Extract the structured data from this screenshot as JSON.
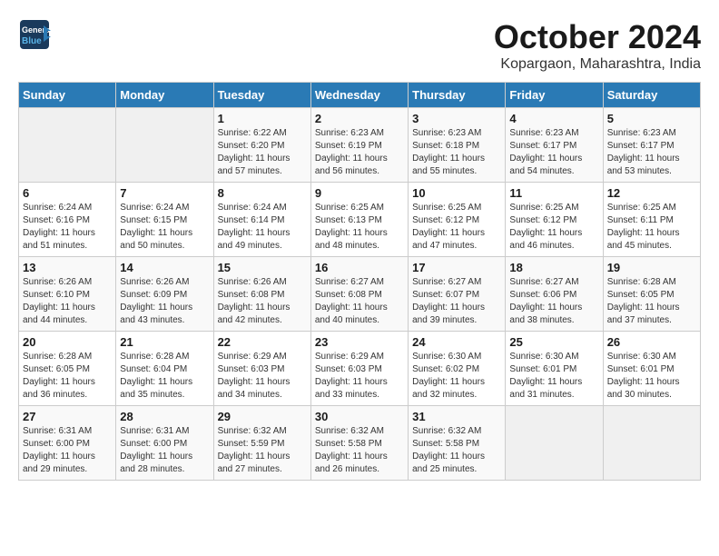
{
  "header": {
    "logo_line1": "General",
    "logo_line2": "Blue",
    "title": "October 2024",
    "subtitle": "Kopargaon, Maharashtra, India"
  },
  "calendar": {
    "headers": [
      "Sunday",
      "Monday",
      "Tuesday",
      "Wednesday",
      "Thursday",
      "Friday",
      "Saturday"
    ],
    "weeks": [
      [
        {
          "day": "",
          "info": ""
        },
        {
          "day": "",
          "info": ""
        },
        {
          "day": "1",
          "info": "Sunrise: 6:22 AM\nSunset: 6:20 PM\nDaylight: 11 hours and 57 minutes."
        },
        {
          "day": "2",
          "info": "Sunrise: 6:23 AM\nSunset: 6:19 PM\nDaylight: 11 hours and 56 minutes."
        },
        {
          "day": "3",
          "info": "Sunrise: 6:23 AM\nSunset: 6:18 PM\nDaylight: 11 hours and 55 minutes."
        },
        {
          "day": "4",
          "info": "Sunrise: 6:23 AM\nSunset: 6:17 PM\nDaylight: 11 hours and 54 minutes."
        },
        {
          "day": "5",
          "info": "Sunrise: 6:23 AM\nSunset: 6:17 PM\nDaylight: 11 hours and 53 minutes."
        }
      ],
      [
        {
          "day": "6",
          "info": "Sunrise: 6:24 AM\nSunset: 6:16 PM\nDaylight: 11 hours and 51 minutes."
        },
        {
          "day": "7",
          "info": "Sunrise: 6:24 AM\nSunset: 6:15 PM\nDaylight: 11 hours and 50 minutes."
        },
        {
          "day": "8",
          "info": "Sunrise: 6:24 AM\nSunset: 6:14 PM\nDaylight: 11 hours and 49 minutes."
        },
        {
          "day": "9",
          "info": "Sunrise: 6:25 AM\nSunset: 6:13 PM\nDaylight: 11 hours and 48 minutes."
        },
        {
          "day": "10",
          "info": "Sunrise: 6:25 AM\nSunset: 6:12 PM\nDaylight: 11 hours and 47 minutes."
        },
        {
          "day": "11",
          "info": "Sunrise: 6:25 AM\nSunset: 6:12 PM\nDaylight: 11 hours and 46 minutes."
        },
        {
          "day": "12",
          "info": "Sunrise: 6:25 AM\nSunset: 6:11 PM\nDaylight: 11 hours and 45 minutes."
        }
      ],
      [
        {
          "day": "13",
          "info": "Sunrise: 6:26 AM\nSunset: 6:10 PM\nDaylight: 11 hours and 44 minutes."
        },
        {
          "day": "14",
          "info": "Sunrise: 6:26 AM\nSunset: 6:09 PM\nDaylight: 11 hours and 43 minutes."
        },
        {
          "day": "15",
          "info": "Sunrise: 6:26 AM\nSunset: 6:08 PM\nDaylight: 11 hours and 42 minutes."
        },
        {
          "day": "16",
          "info": "Sunrise: 6:27 AM\nSunset: 6:08 PM\nDaylight: 11 hours and 40 minutes."
        },
        {
          "day": "17",
          "info": "Sunrise: 6:27 AM\nSunset: 6:07 PM\nDaylight: 11 hours and 39 minutes."
        },
        {
          "day": "18",
          "info": "Sunrise: 6:27 AM\nSunset: 6:06 PM\nDaylight: 11 hours and 38 minutes."
        },
        {
          "day": "19",
          "info": "Sunrise: 6:28 AM\nSunset: 6:05 PM\nDaylight: 11 hours and 37 minutes."
        }
      ],
      [
        {
          "day": "20",
          "info": "Sunrise: 6:28 AM\nSunset: 6:05 PM\nDaylight: 11 hours and 36 minutes."
        },
        {
          "day": "21",
          "info": "Sunrise: 6:28 AM\nSunset: 6:04 PM\nDaylight: 11 hours and 35 minutes."
        },
        {
          "day": "22",
          "info": "Sunrise: 6:29 AM\nSunset: 6:03 PM\nDaylight: 11 hours and 34 minutes."
        },
        {
          "day": "23",
          "info": "Sunrise: 6:29 AM\nSunset: 6:03 PM\nDaylight: 11 hours and 33 minutes."
        },
        {
          "day": "24",
          "info": "Sunrise: 6:30 AM\nSunset: 6:02 PM\nDaylight: 11 hours and 32 minutes."
        },
        {
          "day": "25",
          "info": "Sunrise: 6:30 AM\nSunset: 6:01 PM\nDaylight: 11 hours and 31 minutes."
        },
        {
          "day": "26",
          "info": "Sunrise: 6:30 AM\nSunset: 6:01 PM\nDaylight: 11 hours and 30 minutes."
        }
      ],
      [
        {
          "day": "27",
          "info": "Sunrise: 6:31 AM\nSunset: 6:00 PM\nDaylight: 11 hours and 29 minutes."
        },
        {
          "day": "28",
          "info": "Sunrise: 6:31 AM\nSunset: 6:00 PM\nDaylight: 11 hours and 28 minutes."
        },
        {
          "day": "29",
          "info": "Sunrise: 6:32 AM\nSunset: 5:59 PM\nDaylight: 11 hours and 27 minutes."
        },
        {
          "day": "30",
          "info": "Sunrise: 6:32 AM\nSunset: 5:58 PM\nDaylight: 11 hours and 26 minutes."
        },
        {
          "day": "31",
          "info": "Sunrise: 6:32 AM\nSunset: 5:58 PM\nDaylight: 11 hours and 25 minutes."
        },
        {
          "day": "",
          "info": ""
        },
        {
          "day": "",
          "info": ""
        }
      ]
    ]
  }
}
